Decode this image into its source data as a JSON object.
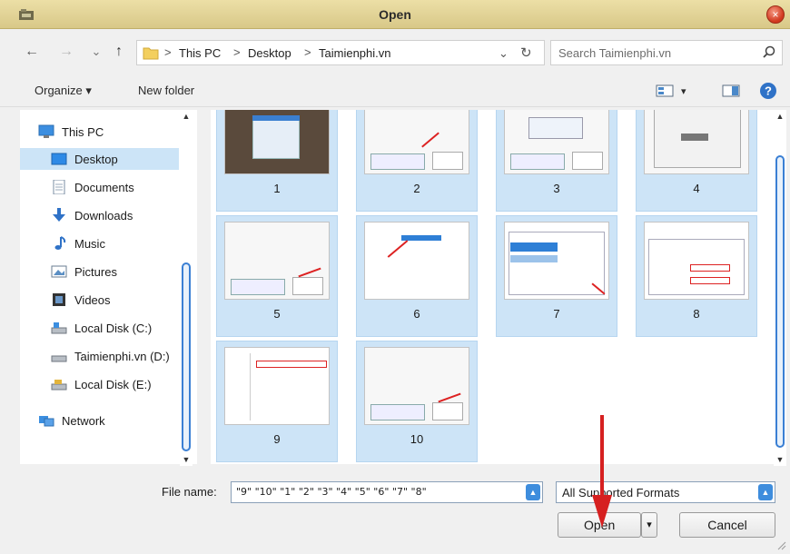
{
  "window": {
    "title": "Open",
    "close_glyph": "×"
  },
  "nav": {
    "back": "←",
    "forward": "→",
    "recent": "⌄",
    "up": "↑"
  },
  "address": {
    "crumbs": [
      "This PC",
      "Desktop",
      "Taimienphi.vn"
    ],
    "separator": ">",
    "dropdown": "⌄",
    "refresh": "↻"
  },
  "search": {
    "placeholder": "Search Taimienphi.vn"
  },
  "toolbar": {
    "organize": "Organize ▾",
    "new_folder": "New folder",
    "view_menu": "▾",
    "help": "?"
  },
  "sidebar": {
    "items": [
      {
        "label": "This PC",
        "icon": "computer-icon"
      },
      {
        "label": "Desktop",
        "icon": "desktop-icon",
        "selected": true
      },
      {
        "label": "Documents",
        "icon": "documents-icon"
      },
      {
        "label": "Downloads",
        "icon": "downloads-icon"
      },
      {
        "label": "Music",
        "icon": "music-icon"
      },
      {
        "label": "Pictures",
        "icon": "pictures-icon"
      },
      {
        "label": "Videos",
        "icon": "videos-icon"
      },
      {
        "label": "Local Disk (C:)",
        "icon": "drive-icon"
      },
      {
        "label": "Taimienphi.vn (D:)",
        "icon": "drive-icon"
      },
      {
        "label": "Local Disk (E:)",
        "icon": "drive-icon"
      },
      {
        "label": "Network",
        "icon": "network-icon"
      }
    ]
  },
  "files": {
    "items": [
      {
        "label": "1"
      },
      {
        "label": "2"
      },
      {
        "label": "3"
      },
      {
        "label": "4"
      },
      {
        "label": "5"
      },
      {
        "label": "6"
      },
      {
        "label": "7"
      },
      {
        "label": "8"
      },
      {
        "label": "9"
      },
      {
        "label": "10"
      }
    ]
  },
  "footer": {
    "file_name_label": "File name:",
    "file_name_value": "\"9\" \"10\" \"1\" \"2\" \"3\" \"4\" \"5\" \"6\" \"7\" \"8\"",
    "file_type": "All Supported Formats",
    "open": "Open",
    "open_menu": "▾",
    "cancel": "Cancel"
  },
  "colors": {
    "selection": "#cde4f7",
    "accent": "#3a7fd4",
    "annotation_arrow": "#d62020"
  }
}
